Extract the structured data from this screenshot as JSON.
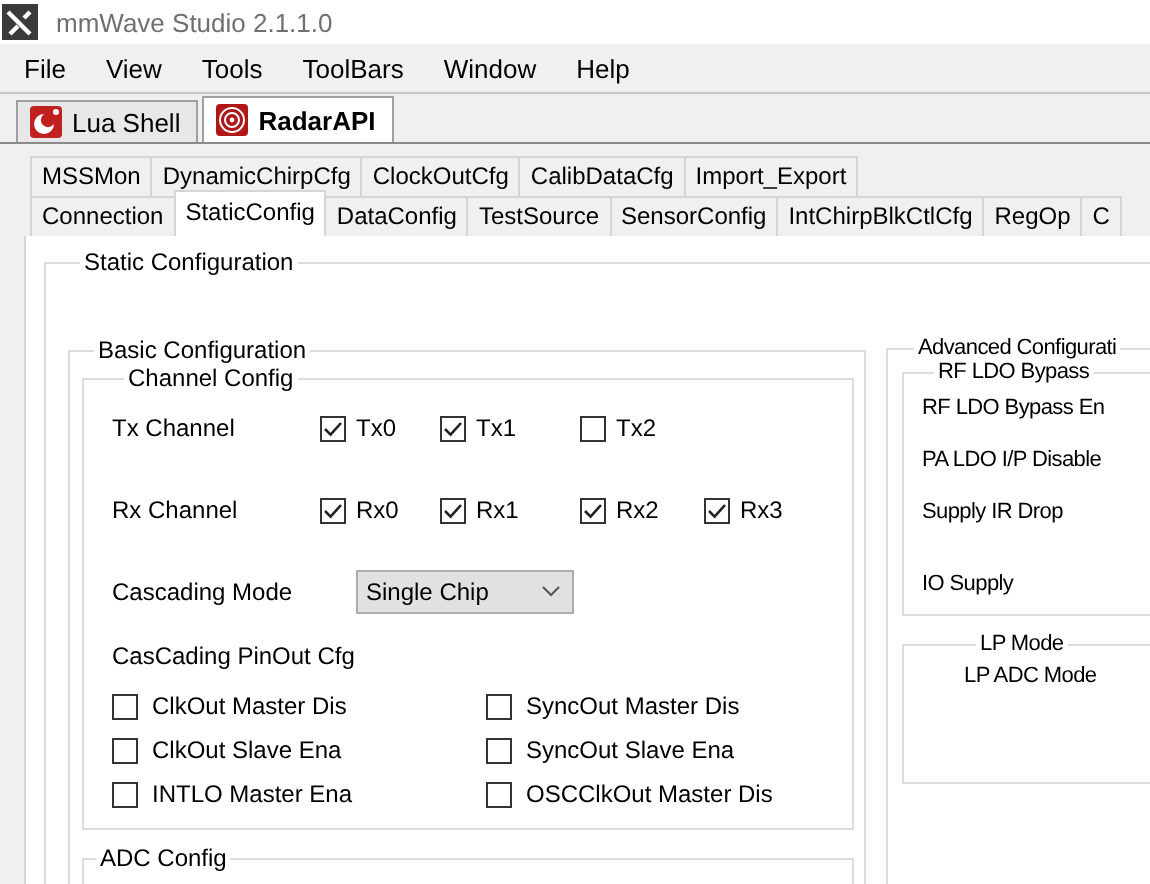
{
  "window": {
    "title": "mmWave Studio 2.1.1.0"
  },
  "menu": [
    "File",
    "View",
    "Tools",
    "ToolBars",
    "Window",
    "Help"
  ],
  "document_tabs": [
    {
      "label": "Lua Shell",
      "kind": "shell",
      "selected": false
    },
    {
      "label": "RadarAPI",
      "kind": "radar",
      "selected": true
    }
  ],
  "tab_rows": [
    [
      {
        "label": "MSSMon",
        "selected": false
      },
      {
        "label": "DynamicChirpCfg",
        "selected": false
      },
      {
        "label": "ClockOutCfg",
        "selected": false
      },
      {
        "label": "CalibDataCfg",
        "selected": false
      },
      {
        "label": "Import_Export",
        "selected": false
      }
    ],
    [
      {
        "label": "Connection",
        "selected": false
      },
      {
        "label": "StaticConfig",
        "selected": true
      },
      {
        "label": "DataConfig",
        "selected": false
      },
      {
        "label": "TestSource",
        "selected": false
      },
      {
        "label": "SensorConfig",
        "selected": false
      },
      {
        "label": "IntChirpBlkCtlCfg",
        "selected": false
      },
      {
        "label": "RegOp",
        "selected": false
      },
      {
        "label": "C",
        "selected": false
      }
    ]
  ],
  "static_configuration": {
    "title": "Static Configuration",
    "basic": {
      "title": "Basic Configuration",
      "channel_config": {
        "title": "Channel Config",
        "tx": {
          "label": "Tx Channel",
          "channels": [
            {
              "label": "Tx0",
              "checked": true
            },
            {
              "label": "Tx1",
              "checked": true
            },
            {
              "label": "Tx2",
              "checked": false
            }
          ]
        },
        "rx": {
          "label": "Rx Channel",
          "channels": [
            {
              "label": "Rx0",
              "checked": true
            },
            {
              "label": "Rx1",
              "checked": true
            },
            {
              "label": "Rx2",
              "checked": true
            },
            {
              "label": "Rx3",
              "checked": true
            }
          ]
        },
        "cascading_mode": {
          "label": "Cascading Mode",
          "value": "Single Chip"
        },
        "pinout": {
          "label": "CasCading PinOut Cfg",
          "options": [
            {
              "label": "ClkOut Master Dis",
              "checked": false
            },
            {
              "label": "SyncOut Master Dis",
              "checked": false
            },
            {
              "label": "ClkOut Slave Ena",
              "checked": false
            },
            {
              "label": "SyncOut Slave Ena",
              "checked": false
            },
            {
              "label": "INTLO Master Ena",
              "checked": false
            },
            {
              "label": "OSCClkOut Master Dis",
              "checked": false
            }
          ]
        }
      },
      "adc_config": {
        "title": "ADC Config"
      }
    },
    "advanced": {
      "title": "Advanced Configurati",
      "rf_ldo_bypass": {
        "title": "RF LDO Bypass",
        "labels": [
          "RF LDO Bypass En",
          "PA LDO I/P Disable",
          "Supply IR Drop",
          "IO Supply"
        ]
      },
      "lp_mode": {
        "title": "LP Mode",
        "labels": [
          "LP ADC Mode"
        ]
      }
    }
  }
}
